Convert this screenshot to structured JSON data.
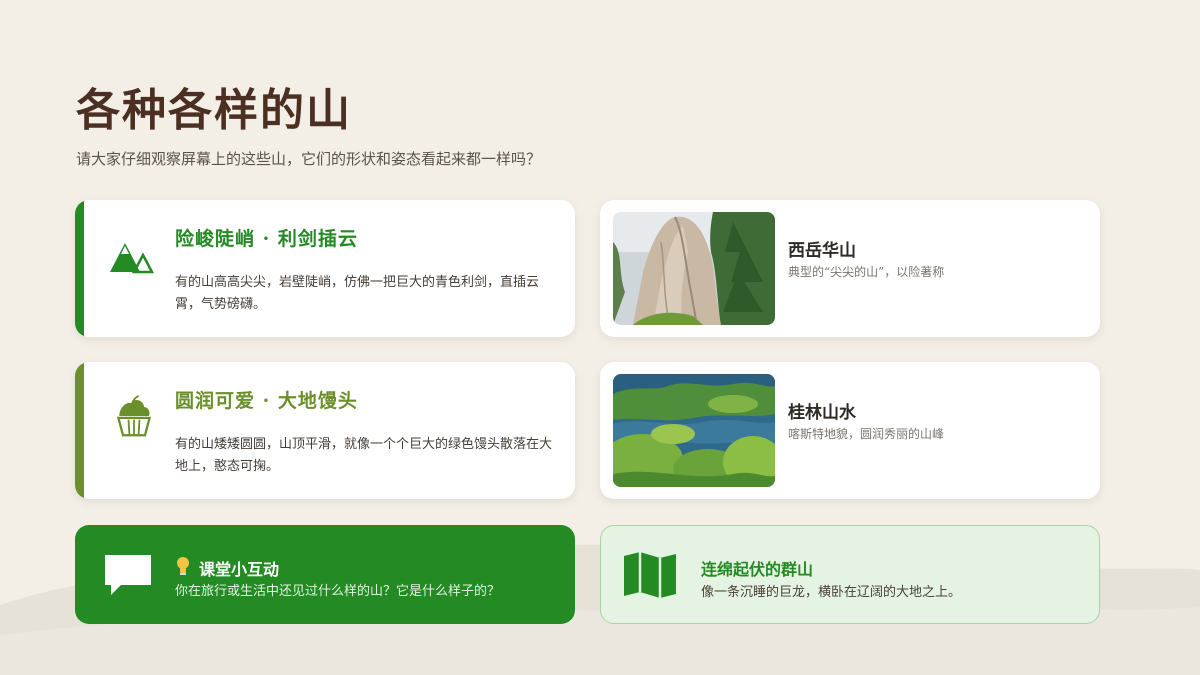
{
  "page": {
    "title": "各种各样的山",
    "subtitle": "请大家仔细观察屏幕上的这些山，它们的形状和姿态看起来都一样吗？"
  },
  "colors": {
    "background": "#f4efe6",
    "title": "#4a2f22",
    "primary_green": "#238a24",
    "olive_green": "#6b8f2a",
    "light_green": "#e5f4e2"
  },
  "features": [
    {
      "icon": "mountain-peaks-icon",
      "title": "险峻陡峭 · 利剑插云",
      "text": "有的山高高尖尖，岩壁陡峭，仿佛一把巨大的青色利剑，直插云霄，气势磅礴。",
      "accent": "#238a24"
    },
    {
      "icon": "cupcake-hill-icon",
      "title": "圆润可爱 · 大地馒头",
      "text": "有的山矮矮圆圆，山顶平滑，就像一个个巨大的绿色馒头散落在大地上，憨态可掬。",
      "accent": "#6b8f2a"
    }
  ],
  "examples": [
    {
      "image": "huashan-cliff-photo",
      "name": "西岳华山",
      "desc": "典型的“尖尖的山”，以险著称"
    },
    {
      "image": "guilin-karst-photo",
      "name": "桂林山水",
      "desc": "喀斯特地貌，圆润秀丽的山峰"
    }
  ],
  "interactive": {
    "icon": "chat-bubble-icon",
    "bulb_icon": "lightbulb-icon",
    "title": "课堂小互动",
    "question": "你在旅行或生活中还见过什么样的山？它是什么样子的？"
  },
  "range": {
    "icon": "folded-map-icon",
    "title": "连绵起伏的群山",
    "text": "像一条沉睡的巨龙，横卧在辽阔的大地之上。"
  }
}
